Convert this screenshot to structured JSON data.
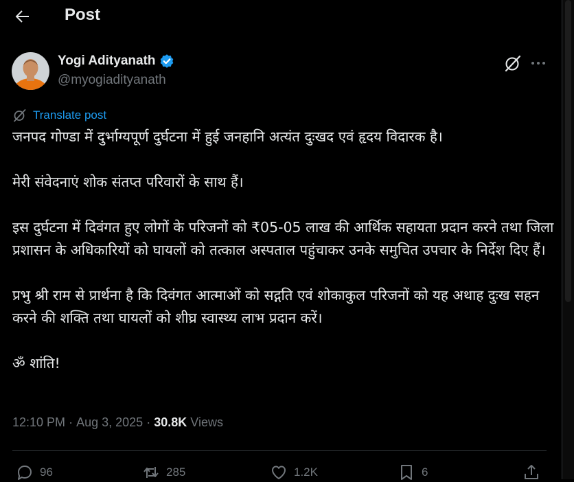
{
  "header": {
    "title": "Post"
  },
  "author": {
    "name": "Yogi Adityanath",
    "handle": "@myogiadityanath"
  },
  "translate_label": "Translate post",
  "tweet": {
    "paragraphs": [
      "जनपद गोण्डा में दुर्भाग्यपूर्ण दुर्घटना में हुई जनहानि अत्यंत दुःखद एवं हृदय विदारक है।",
      "मेरी संवेदनाएं शोक संतप्त परिवारों के साथ हैं।",
      "इस दुर्घटना में दिवंगत हुए लोगों के परिजनों को ₹05-05 लाख की आर्थिक सहायता प्रदान करने तथा जिला प्रशासन के अधिकारियों को घायलों को तत्काल अस्पताल पहुंचाकर उनके समुचित उपचार के निर्देश दिए हैं।",
      "प्रभु श्री राम से प्रार्थना है कि दिवंगत आत्माओं को सद्गति एवं शोकाकुल परिजनों को यह अथाह दुःख सहन करने की शक्ति तथा घायलों को शीघ्र स्वास्थ्य लाभ प्रदान करें।",
      "ॐ शांति!"
    ]
  },
  "meta": {
    "time": "12:10 PM",
    "dot": "·",
    "date": "Aug 3, 2025",
    "views_count": "30.8K",
    "views_label": "Views"
  },
  "actions": {
    "replies": "96",
    "reposts": "285",
    "likes": "1.2K",
    "bookmarks": "6"
  },
  "colors": {
    "background": "#000000",
    "text": "#e7e9ea",
    "secondary": "#71767b",
    "accent": "#1d9bf0",
    "divider": "#2f3336"
  },
  "icons": [
    "back-arrow-icon",
    "verified-badge-icon",
    "grok-icon",
    "more-icon",
    "translate-icon",
    "reply-icon",
    "repost-icon",
    "like-icon",
    "bookmark-icon",
    "share-icon"
  ]
}
